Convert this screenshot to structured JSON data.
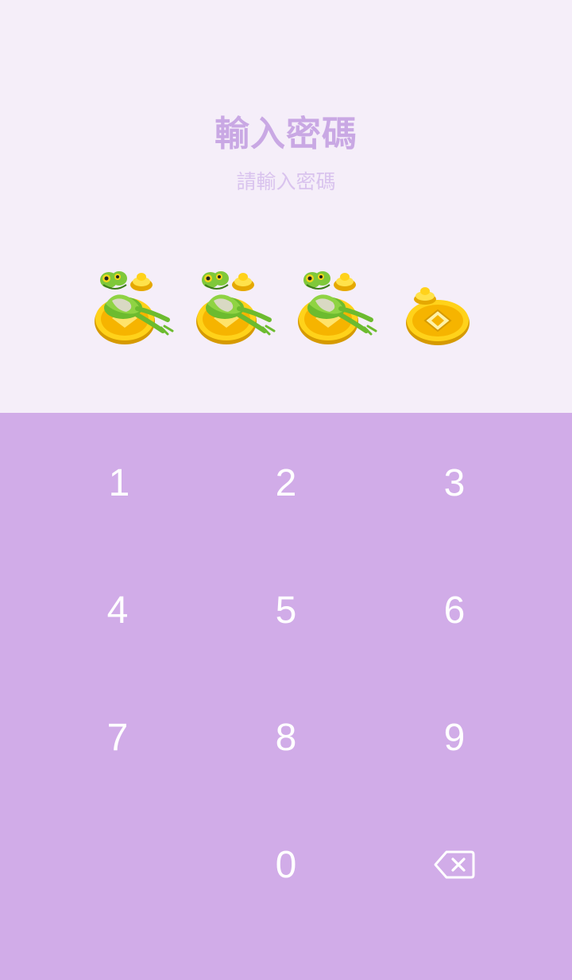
{
  "header": {
    "title": "輸入密碼",
    "subtitle": "請輸入密碼"
  },
  "pin": {
    "length": 4,
    "entered": 3,
    "filled_icon": "frog-on-gold-coin-icon",
    "empty_icon": "gold-coin-icon"
  },
  "keypad": {
    "keys": [
      "1",
      "2",
      "3",
      "4",
      "5",
      "6",
      "7",
      "8",
      "9",
      "",
      "0",
      "backspace"
    ],
    "backspace_icon": "backspace-icon"
  },
  "colors": {
    "background": "#f5eef9",
    "keypad_background": "#d1ace8",
    "title": "#c9a8e4",
    "subtitle": "#d9c3ee",
    "key_text": "#ffffff"
  }
}
